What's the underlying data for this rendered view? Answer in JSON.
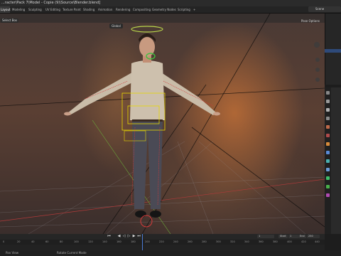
{
  "title": "...racter\\Pack 7\\Model - Copie (9)\\Source\\Blender.blend]",
  "tabs": [
    "Layout",
    "Modeling",
    "Sculpting",
    "UV Editing",
    "Texture Paint",
    "Shading",
    "Animation",
    "Rendering",
    "Compositing",
    "Geometry Nodes",
    "Scripting",
    "+"
  ],
  "active_tab": "Layout",
  "scene": "Scene",
  "viewport": {
    "select_box": "Select Box",
    "transform_orientation": "Global",
    "pose_options": "Pose Options"
  },
  "timeline": {
    "start_label": "Start",
    "start": "1",
    "end_label": "End",
    "end": "250",
    "current_frame": "1",
    "ruler": [
      "0",
      "20",
      "40",
      "60",
      "80",
      "100",
      "120",
      "140",
      "160",
      "180",
      "200",
      "220",
      "240",
      "260",
      "280",
      "300",
      "320",
      "340",
      "360",
      "380",
      "400",
      "420",
      "440"
    ]
  },
  "status": {
    "left": "Pan View",
    "middle": "Rotate Current Mode"
  },
  "colors": {
    "accent": "#4a7bd6",
    "bone_yellow": "#e6d600",
    "bone_green": "#3fbf3f",
    "bone_red": "#d43a3a"
  }
}
